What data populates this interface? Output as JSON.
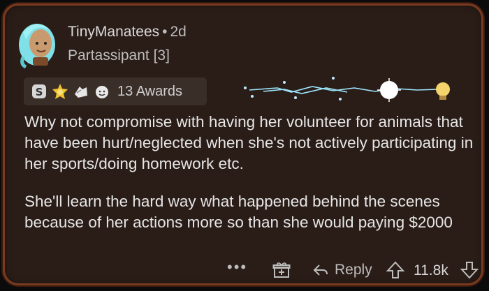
{
  "comment": {
    "username": "TinyManatees",
    "separator": "•",
    "age": "2d",
    "flair": "Partassipant [3]",
    "awards_label": "13 Awards",
    "paragraphs": [
      "Why not compromise with having her volunteer for animals that have been hurt/neglected when she's not actively participating in her sports/doing homework etc.",
      "She'll learn the hard way what happened behind the scenes because of her actions more so than she would paying $2000"
    ],
    "actions": {
      "more": "•••",
      "reply": "Reply",
      "score": "11.8k"
    }
  },
  "colors": {
    "card_bg": "#2a1d18",
    "card_border": "#7a3a1f",
    "text": "#e6e6e6",
    "muted": "#bdbdbd"
  }
}
